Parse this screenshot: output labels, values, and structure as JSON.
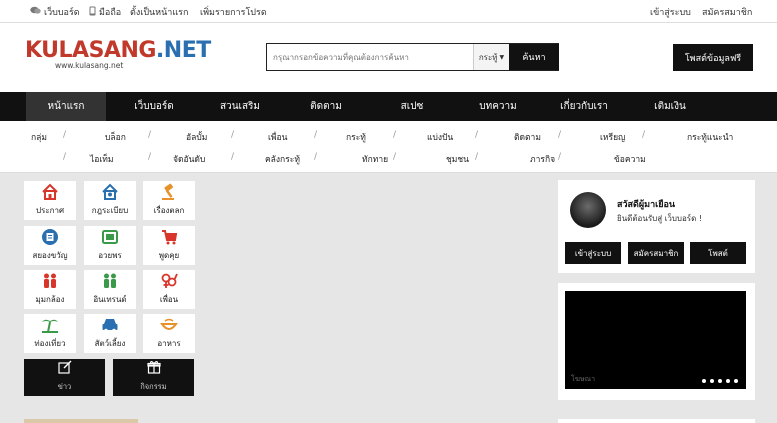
{
  "topbar": {
    "left_links": [
      {
        "label": "เว็บบอร์ด",
        "icon": "chat-icon"
      },
      {
        "label": "มือถือ",
        "icon": "mobile-icon"
      },
      {
        "label": "ตั้งเป็นหน้าแรก",
        "icon": ""
      },
      {
        "label": "เพิ่มรายการโปรด",
        "icon": ""
      }
    ],
    "login": "เข้าสู่ระบบ",
    "register": "สมัครสมาชิก"
  },
  "header": {
    "logo_main": "KULASANG",
    "logo_net": ".NET",
    "logo_sub": "www.kulasang.net",
    "search_placeholder": "กรุณากรอกข้อความที่คุณต้องการค้นหา",
    "search_scope": "กระทู้",
    "search_button": "ค้นหา",
    "post_button": "โพสต์ข้อมูลฟรี"
  },
  "main_nav": [
    "หน้าแรก",
    "เว็บบอร์ด",
    "สวนเสริม",
    "ติดตาม",
    "สเปซ",
    "บทความ",
    "เกี่ยวกับเรา",
    "เติมเงิน"
  ],
  "sub_nav_row1": [
    "กลุ่ม",
    "บล็อก",
    "อัลบั้ม",
    "เพื่อน",
    "กระทู้",
    "แบ่งปัน",
    "ติดตาม",
    "เหรียญ",
    "กระทู้แนะนำ"
  ],
  "sub_nav_row2": [
    "ไอเท็ม",
    "จัดอันดับ",
    "คลังกระทู้",
    "ทักทาย",
    "ชุมชน",
    "ภารกิจ",
    "ข้อความ"
  ],
  "tiles": [
    {
      "label": "ประกาศ",
      "icon": "home-icon",
      "color": "#d9362b"
    },
    {
      "label": "กฎระเบียบ",
      "icon": "rules-home-icon",
      "color": "#2a6fb0"
    },
    {
      "label": "เรื่องตลก",
      "icon": "gavel-icon",
      "color": "#e8912b"
    },
    {
      "label": "สยองขวัญ",
      "icon": "clipboard-icon",
      "color": "#2a6fb0"
    },
    {
      "label": "อวยพร",
      "icon": "card-icon",
      "color": "#3a9a4a"
    },
    {
      "label": "พูดคุย",
      "icon": "chat-cart-icon",
      "color": "#d9362b"
    },
    {
      "label": "มุมกล้อง",
      "icon": "people-icon",
      "color": "#d9362b"
    },
    {
      "label": "อินเทรนด์",
      "icon": "trend-people-icon",
      "color": "#3a9a4a"
    },
    {
      "label": "เพื่อน",
      "icon": "gender-icon",
      "color": "#d9362b"
    },
    {
      "label": "ท่องเที่ยว",
      "icon": "palm-tree-icon",
      "color": "#3a9a4a"
    },
    {
      "label": "สัตว์เลี้ยง",
      "icon": "car-icon",
      "color": "#2a6fb0"
    },
    {
      "label": "อาหาร",
      "icon": "bowl-icon",
      "color": "#e8912b"
    }
  ],
  "dark_tiles": [
    {
      "label": "ข่าว",
      "icon": "edit-icon"
    },
    {
      "label": "กิจกรรม",
      "icon": "gift-icon"
    }
  ],
  "user_panel": {
    "greeting": "สวัสดีผู้มาเยือน",
    "welcome": "ยินดีต้อนรับสู่ เว็บบอร์ด !",
    "login_button": "เข้าสู่ระบบ",
    "register_button": "สมัครสมาชิก",
    "post_button": "โพสต์"
  },
  "media": {
    "caption": "โฆษณา",
    "slides": 5
  }
}
